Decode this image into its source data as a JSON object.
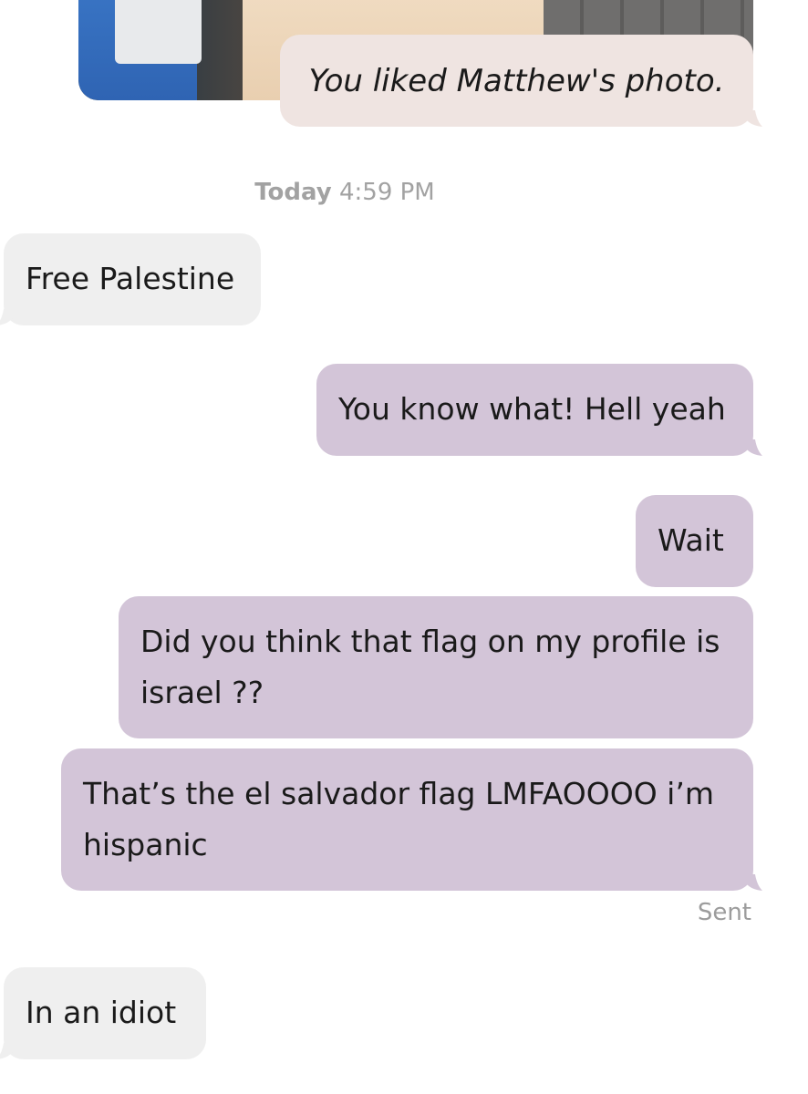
{
  "liked_photo": {
    "caption": "You liked Matthew's photo."
  },
  "timestamp": {
    "day": "Today",
    "time": "4:59 PM"
  },
  "messages": [
    {
      "direction": "incoming",
      "text": "Free Palestine"
    },
    {
      "direction": "outgoing",
      "text": "You know what! Hell yeah"
    },
    {
      "direction": "outgoing",
      "text": "Wait"
    },
    {
      "direction": "outgoing",
      "text": "Did you think that flag on my profile is israel ??"
    },
    {
      "direction": "outgoing",
      "text": "That’s the el salvador flag LMFAOOOO i’m hispanic"
    },
    {
      "direction": "incoming",
      "text": "In an idiot"
    }
  ],
  "status": {
    "sent_label": "Sent"
  },
  "colors": {
    "incoming_bubble": "#efefef",
    "outgoing_bubble": "#d3c5d8",
    "liked_caption_bubble": "#efe4e1",
    "meta_text": "#a2a2a2"
  }
}
